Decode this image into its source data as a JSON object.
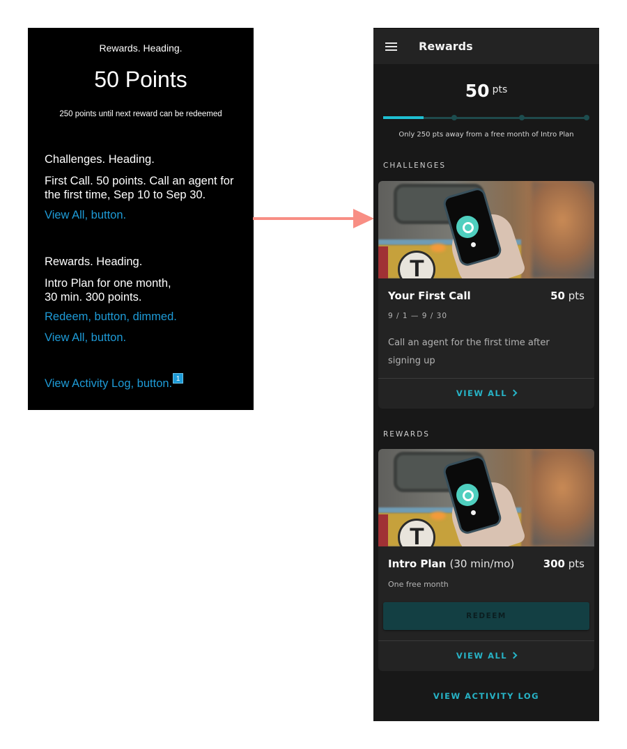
{
  "screen_reader": {
    "rewards_heading": "Rewards. Heading.",
    "points": "50 Points",
    "subtext": "250 points until next reward can be redeemed",
    "challenges_heading": "Challenges. Heading.",
    "challenge_item": "First Call. 50 points. Call an agent for the first time, Sep 10 to Sep 30.",
    "view_all_1": "View All, button.",
    "rewards_heading_2": "Rewards. Heading.",
    "reward_item_line1": "Intro Plan for one month,",
    "reward_item_line2": "30 min. 300 points.",
    "redeem": "Redeem, button, dimmed.",
    "view_all_2": "View All, button.",
    "activity_log": "View Activity Log, button.",
    "badge": "1"
  },
  "colors": {
    "accent": "#27b3c6",
    "progress_fill": "#1fc0d2",
    "sr_link": "#1e9bd7",
    "arrow": "#f88e84",
    "redeem_bg": "#133f43"
  },
  "app": {
    "menu_icon": "hamburger-icon",
    "title": "Rewards",
    "points_value": "50",
    "points_unit": "pts",
    "progress": {
      "current": 50,
      "max": 300,
      "fraction": 0.1667,
      "milestones": 3
    },
    "progress_caption": "Only 250 pts away from a free month of Intro Plan",
    "challenges": {
      "label": "CHALLENGES",
      "card": {
        "title": "Your First Call",
        "points_value": "50",
        "points_unit": "pts",
        "dates": "9 / 1  —  9 / 30",
        "description": "Call an agent for the first time after signing up",
        "view_all": "VIEW ALL"
      }
    },
    "rewards": {
      "label": "REWARDS",
      "card": {
        "title": "Intro Plan",
        "title_detail": "(30 min/mo)",
        "points_value": "300",
        "points_unit": "pts",
        "subtitle": "One free month",
        "redeem": "REDEEM",
        "view_all": "VIEW ALL"
      }
    },
    "activity_log": "VIEW ACTIVITY LOG"
  }
}
